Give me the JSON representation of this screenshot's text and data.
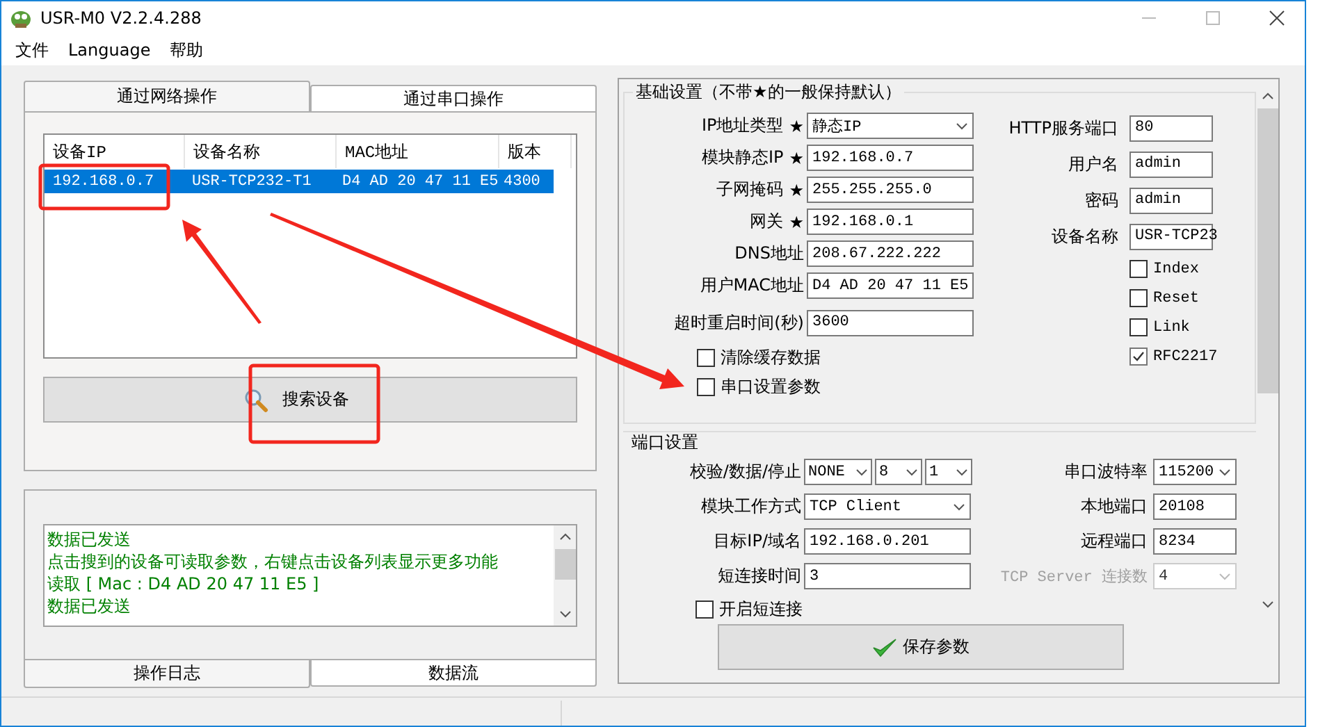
{
  "window": {
    "title": "USR-M0 V2.2.4.288"
  },
  "menu": [
    {
      "label": "文件"
    },
    {
      "label": "Language"
    },
    {
      "label": "帮助"
    }
  ],
  "device_tabs": [
    {
      "label": "通过网络操作",
      "selected": true
    },
    {
      "label": "通过串口操作",
      "selected": false
    }
  ],
  "device_table": {
    "columns": [
      "设备IP",
      "设备名称",
      "MAC地址",
      "版本"
    ],
    "rows": [
      {
        "cells": [
          "192.168.0.7",
          "USR-TCP232-T1",
          "D4 AD 20 47 11 E5",
          "4300"
        ],
        "selected": true
      }
    ]
  },
  "search_button": "搜索设备",
  "log": {
    "lines": [
      "数据已发送",
      "点击搜到的设备可读取参数，右键点击设备列表显示更多功能",
      "读取 [ Mac : D4 AD 20 47 11 E5 ]",
      "数据已发送"
    ]
  },
  "log_tabs": [
    {
      "label": "操作日志",
      "selected": true
    },
    {
      "label": "数据流",
      "selected": false
    }
  ],
  "basic_settings": {
    "title": "基础设置（不带★的一般保持默认）",
    "left": [
      {
        "kind": "field",
        "label": "IP地址类型",
        "star": "★",
        "controls": [
          {
            "kind": "select",
            "value": "静态IP"
          }
        ]
      },
      {
        "kind": "field",
        "label": "模块静态IP",
        "star": "★",
        "controls": [
          {
            "kind": "input",
            "value": "192.168.0.7"
          }
        ]
      },
      {
        "kind": "field",
        "label": "子网掩码",
        "star": "★",
        "controls": [
          {
            "kind": "input",
            "value": "255.255.255.0"
          }
        ]
      },
      {
        "kind": "field",
        "label": "网关",
        "star": "★",
        "controls": [
          {
            "kind": "input",
            "value": "192.168.0.1"
          }
        ]
      },
      {
        "kind": "field",
        "label": "DNS地址",
        "controls": [
          {
            "kind": "input",
            "value": "208.67.222.222"
          }
        ]
      },
      {
        "kind": "field",
        "label": "用户MAC地址",
        "controls": [
          {
            "kind": "input",
            "value": "D4 AD 20 47 11 E5"
          }
        ]
      },
      {
        "kind": "field",
        "label": "超时重启时间(秒)",
        "controls": [
          {
            "kind": "input",
            "value": "3600"
          }
        ]
      },
      {
        "kind": "checkbox",
        "label": "清除缓存数据",
        "checked": false
      },
      {
        "kind": "checkbox",
        "label": "串口设置参数",
        "checked": false
      }
    ],
    "right": [
      {
        "kind": "field",
        "label": "HTTP服务端口",
        "controls": [
          {
            "kind": "input",
            "value": "80"
          }
        ]
      },
      {
        "kind": "field",
        "label": "用户名",
        "controls": [
          {
            "kind": "input",
            "value": "admin"
          }
        ]
      },
      {
        "kind": "field",
        "label": "密码",
        "controls": [
          {
            "kind": "input",
            "value": "admin"
          }
        ]
      },
      {
        "kind": "field",
        "label": "设备名称",
        "controls": [
          {
            "kind": "input",
            "value": "USR-TCP23"
          }
        ]
      },
      {
        "kind": "checkbox",
        "label": "Index",
        "checked": false
      },
      {
        "kind": "checkbox",
        "label": "Reset",
        "checked": false
      },
      {
        "kind": "checkbox",
        "label": "Link",
        "checked": false
      },
      {
        "kind": "checkbox",
        "label": "RFC2217",
        "checked": true
      }
    ]
  },
  "port_settings": {
    "title": "端口设置",
    "left": [
      {
        "kind": "field",
        "label": "校验/数据/停止",
        "controls": [
          {
            "kind": "select",
            "value": "NONE"
          },
          {
            "kind": "select",
            "value": "8"
          },
          {
            "kind": "select",
            "value": "1"
          }
        ]
      },
      {
        "kind": "field",
        "label": "模块工作方式",
        "controls": [
          {
            "kind": "select",
            "value": "TCP Client"
          }
        ]
      },
      {
        "kind": "field",
        "label": "目标IP/域名",
        "controls": [
          {
            "kind": "input",
            "value": "192.168.0.201"
          }
        ]
      },
      {
        "kind": "field",
        "label": "短连接时间",
        "controls": [
          {
            "kind": "input",
            "value": "3"
          }
        ]
      },
      {
        "kind": "checkbox",
        "label": "开启短连接",
        "checked": false
      }
    ],
    "right": [
      {
        "kind": "field",
        "label": "串口波特率",
        "disabled": false,
        "controls": [
          {
            "kind": "select",
            "value": "115200"
          }
        ]
      },
      {
        "kind": "field",
        "label": "本地端口",
        "disabled": false,
        "controls": [
          {
            "kind": "input",
            "value": "20108"
          }
        ]
      },
      {
        "kind": "field",
        "label": "远程端口",
        "disabled": false,
        "controls": [
          {
            "kind": "input",
            "value": "8234"
          }
        ]
      },
      {
        "kind": "field",
        "label": "TCP Server 连接数",
        "disabled": true,
        "controls": [
          {
            "kind": "select",
            "value": "4"
          }
        ]
      }
    ]
  },
  "save_button": "保存参数"
}
